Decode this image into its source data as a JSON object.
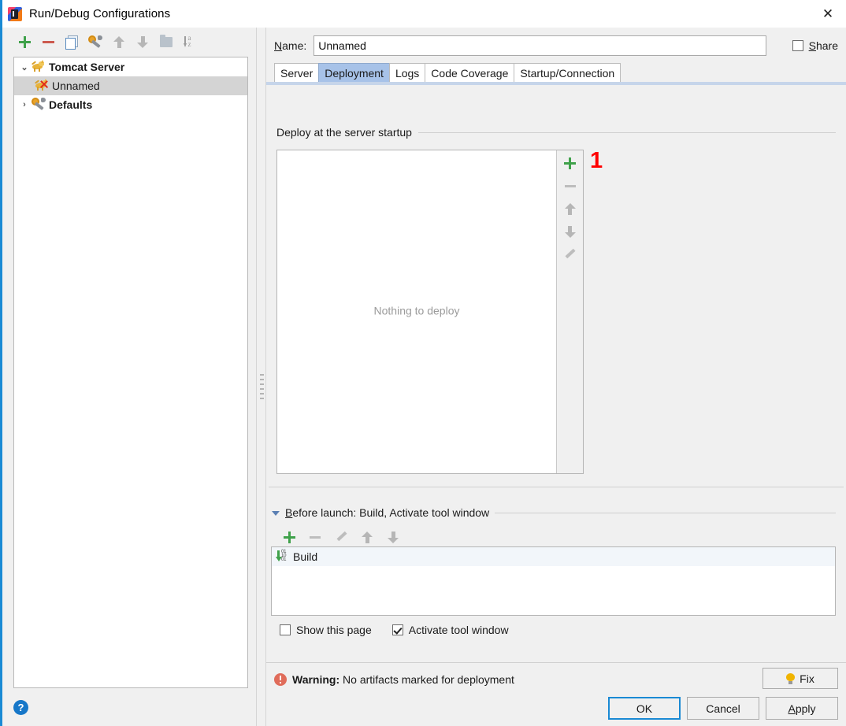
{
  "window": {
    "title": "Run/Debug Configurations",
    "app_icon": "intellij-idea-logo",
    "close_label": "✕"
  },
  "left_pane": {
    "toolbar": [
      {
        "name": "add-configuration-button",
        "icon": "plus-icon",
        "label": "+"
      },
      {
        "name": "remove-configuration-button",
        "icon": "minus-icon",
        "label": "−"
      },
      {
        "name": "copy-configuration-button",
        "icon": "copy-icon",
        "label": "Copy Configuration"
      },
      {
        "name": "edit-defaults-button",
        "icon": "wrench-gear-icon",
        "label": "Edit defaults"
      },
      {
        "name": "move-up-button",
        "icon": "arrow-up-icon",
        "label": "Move Up"
      },
      {
        "name": "move-down-button",
        "icon": "arrow-down-icon",
        "label": "Move Down"
      },
      {
        "name": "create-folder-button",
        "icon": "folder-icon",
        "label": "Create New Folder"
      },
      {
        "name": "sort-configurations-button",
        "icon": "sort-az-icon",
        "label": "Sort Configurations"
      }
    ],
    "tree": [
      {
        "label": "Tomcat Server",
        "icon": "tomcat-icon",
        "twisty": "⌄",
        "expanded": true,
        "selected": false,
        "bold": true,
        "indent": 0
      },
      {
        "label": "Unnamed",
        "icon": "tomcat-invalid-icon",
        "twisty": "",
        "expanded": false,
        "selected": true,
        "bold": false,
        "indent": 1
      },
      {
        "label": "Defaults",
        "icon": "wrench-gear-icon",
        "twisty": "›",
        "expanded": false,
        "selected": false,
        "bold": true,
        "indent": 0
      }
    ],
    "help_button": "?"
  },
  "right_pane": {
    "name_label": "Name:",
    "name_mnemonic": "N",
    "name_value": "Unnamed",
    "share": {
      "label": "Share",
      "mnemonic": "S",
      "checked": false
    },
    "tabs": [
      {
        "label": "Server",
        "active": false
      },
      {
        "label": "Deployment",
        "active": true
      },
      {
        "label": "Logs",
        "active": false
      },
      {
        "label": "Code Coverage",
        "active": false
      },
      {
        "label": "Startup/Connection",
        "active": false
      }
    ],
    "deploy_group": {
      "title": "Deploy at the server startup",
      "empty_text": "Nothing to deploy",
      "side_buttons": [
        {
          "name": "add-artifact-button",
          "icon": "plus-icon"
        },
        {
          "name": "remove-artifact-button",
          "icon": "minus-icon"
        },
        {
          "name": "artifact-move-up-button",
          "icon": "arrow-up-icon"
        },
        {
          "name": "artifact-move-down-button",
          "icon": "arrow-down-icon"
        },
        {
          "name": "edit-artifact-button",
          "icon": "pencil-icon"
        }
      ]
    },
    "annotation": "1",
    "annotation_color": "#ff0000",
    "before_launch": {
      "title": "Before launch: Build, Activate tool window",
      "mnemonic": "B",
      "toolbar": [
        {
          "name": "before-launch-add-button",
          "icon": "plus-icon"
        },
        {
          "name": "before-launch-remove-button",
          "icon": "minus-icon"
        },
        {
          "name": "before-launch-edit-button",
          "icon": "pencil-icon"
        },
        {
          "name": "before-launch-move-up-button",
          "icon": "arrow-up-icon"
        },
        {
          "name": "before-launch-move-down-button",
          "icon": "arrow-down-icon"
        }
      ],
      "tasks": [
        {
          "label": "Build",
          "icon": "build-icon"
        }
      ],
      "checkboxes": [
        {
          "label": "Show this page",
          "checked": false,
          "name": "show-this-page-checkbox"
        },
        {
          "label": "Activate tool window",
          "checked": true,
          "name": "activate-tool-window-checkbox"
        }
      ]
    },
    "warning": {
      "prefix": "Warning:",
      "message": " No artifacts marked for deployment",
      "icon": "warning-icon",
      "fix_label": "Fix",
      "fix_icon": "lightbulb-icon"
    },
    "footer": [
      {
        "label": "OK",
        "name": "ok-button",
        "default": true
      },
      {
        "label": "Cancel",
        "name": "cancel-button",
        "default": false
      },
      {
        "label": "Apply",
        "name": "apply-button",
        "default": false,
        "mnemonic": "A"
      }
    ]
  },
  "colors": {
    "accent": "#1a8ad4",
    "tab_active": "#a7c2e8",
    "warning": "#e06c5a",
    "green": "#3fa14a",
    "annotation_red": "#ff0000"
  }
}
